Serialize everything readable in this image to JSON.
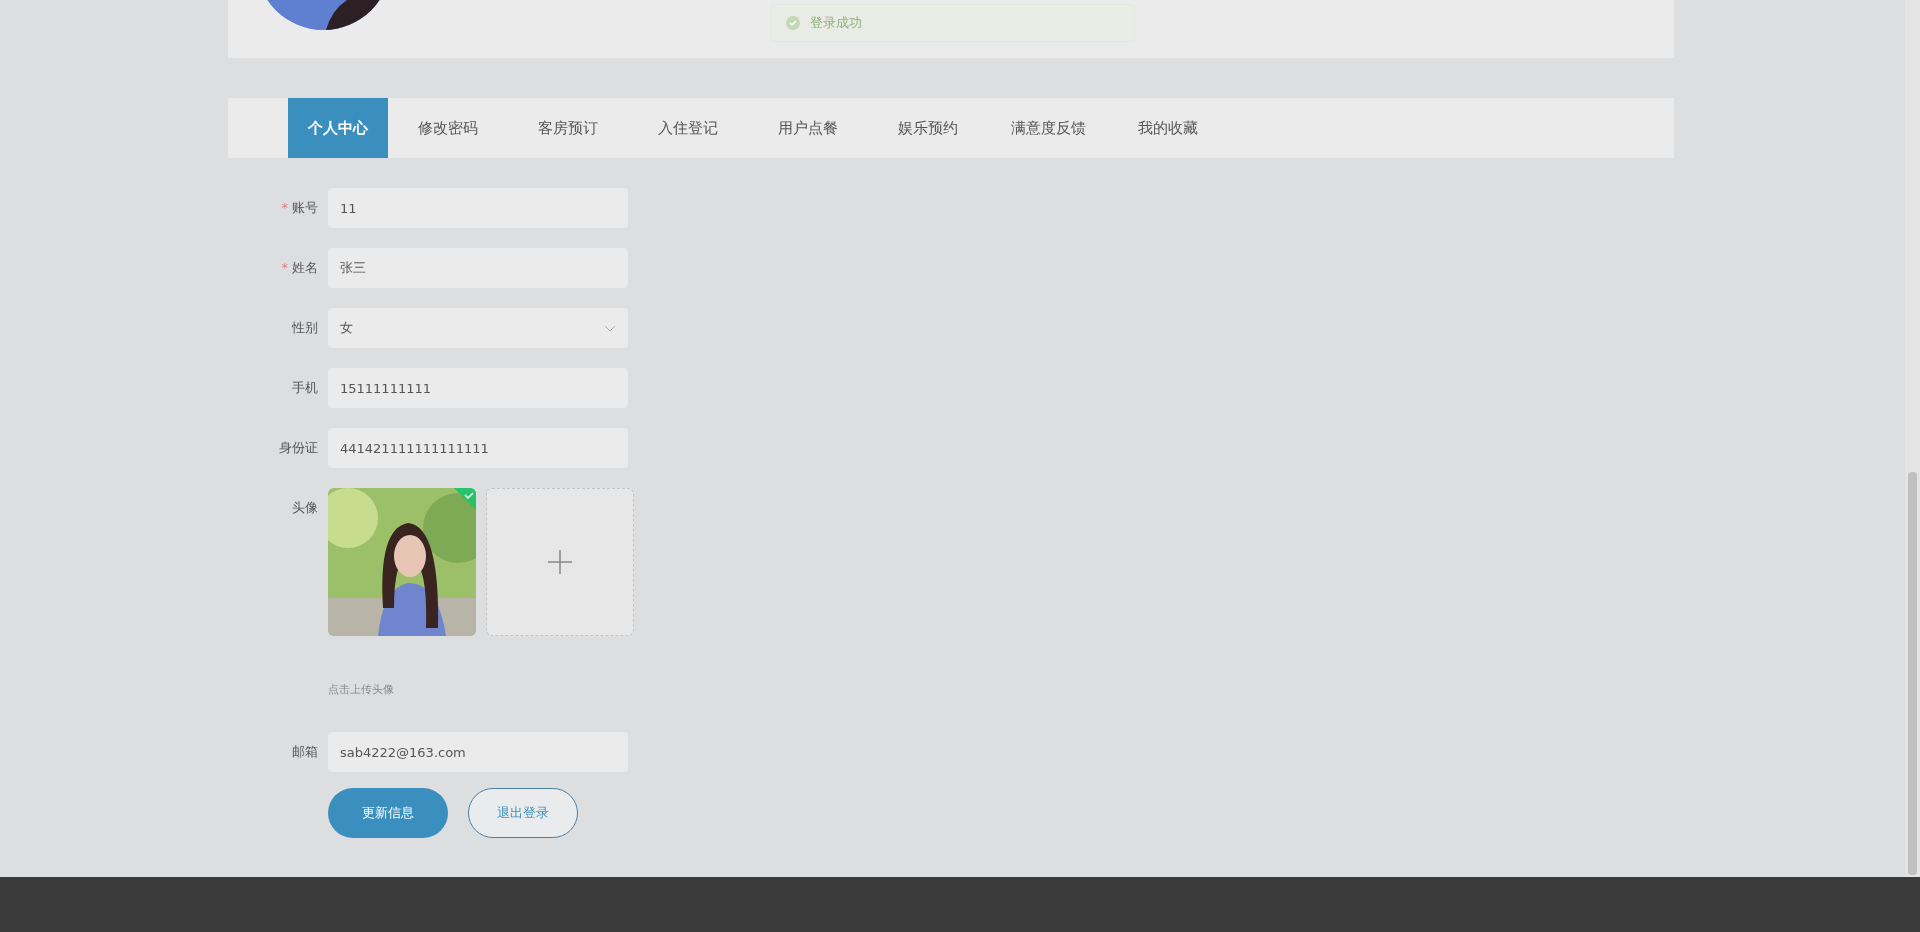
{
  "header": {
    "toast": {
      "text": "登录成功"
    }
  },
  "tabs": [
    {
      "label": "个人中心",
      "selected": true
    },
    {
      "label": "修改密码",
      "selected": false
    },
    {
      "label": "客房预订",
      "selected": false
    },
    {
      "label": "入住登记",
      "selected": false
    },
    {
      "label": "用户点餐",
      "selected": false
    },
    {
      "label": "娱乐预约",
      "selected": false
    },
    {
      "label": "满意度反馈",
      "selected": false
    },
    {
      "label": "我的收藏",
      "selected": false
    }
  ],
  "form": {
    "fields": [
      {
        "kind": "text",
        "mark": "*",
        "label": "账号",
        "value": "11"
      },
      {
        "kind": "text",
        "mark": "*",
        "label": "姓名",
        "value": "张三"
      },
      {
        "kind": "select",
        "label": "性别",
        "value": "女"
      },
      {
        "kind": "text",
        "label": "手机",
        "value": "15111111111"
      },
      {
        "kind": "text",
        "label": "身份证",
        "value": "441421111111111111"
      },
      {
        "label": "头像",
        "uploaded": true,
        "hint": "点击上传头像"
      },
      {
        "kind": "text",
        "label": "邮箱",
        "value": "sab4222@163.com"
      }
    ],
    "buttons": [
      {
        "kind": "primary",
        "label": "更新信息"
      },
      {
        "kind": "outline",
        "label": "退出登录"
      }
    ]
  }
}
